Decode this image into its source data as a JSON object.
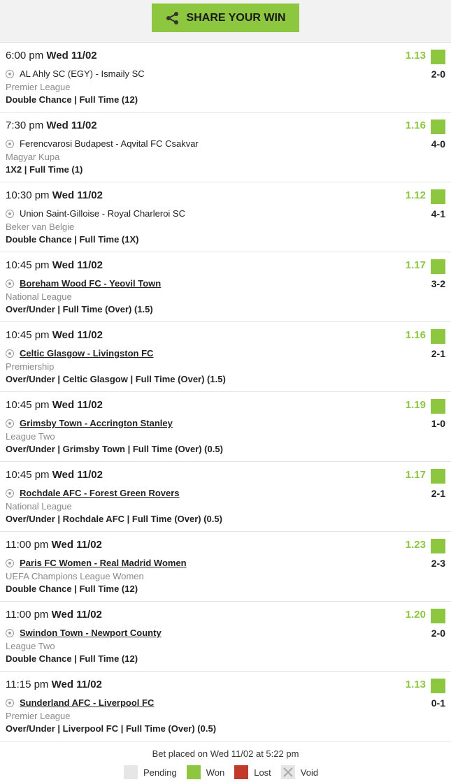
{
  "share_button": {
    "label": "SHARE YOUR WIN"
  },
  "bets": [
    {
      "time": "6:00 pm",
      "date": "Wed 11/02",
      "odds": "1.13",
      "match": "AL Ahly SC (EGY) - Ismaily SC",
      "linked": false,
      "score": "2-0",
      "league": "Premier League",
      "market": "Double Chance | Full Time (12)",
      "status": "won"
    },
    {
      "time": "7:30 pm",
      "date": "Wed 11/02",
      "odds": "1.16",
      "match": "Ferencvarosi Budapest - Aqvital FC Csakvar",
      "linked": false,
      "score": "4-0",
      "league": "Magyar Kupa",
      "market": "1X2 | Full Time (1)",
      "status": "won"
    },
    {
      "time": "10:30 pm",
      "date": "Wed 11/02",
      "odds": "1.12",
      "match": "Union Saint-Gilloise - Royal Charleroi SC",
      "linked": false,
      "score": "4-1",
      "league": "Beker van Belgie",
      "market": "Double Chance | Full Time (1X)",
      "status": "won"
    },
    {
      "time": "10:45 pm",
      "date": "Wed 11/02",
      "odds": "1.17",
      "match": "Boreham Wood FC - Yeovil Town",
      "linked": true,
      "score": "3-2",
      "league": "National League",
      "market": "Over/Under | Full Time (Over) (1.5)",
      "status": "won"
    },
    {
      "time": "10:45 pm",
      "date": "Wed 11/02",
      "odds": "1.16",
      "match": "Celtic Glasgow - Livingston FC",
      "linked": true,
      "score": "2-1",
      "league": "Premiership",
      "market": "Over/Under | Celtic Glasgow | Full Time (Over) (1.5)",
      "status": "won"
    },
    {
      "time": "10:45 pm",
      "date": "Wed 11/02",
      "odds": "1.19",
      "match": "Grimsby Town - Accrington Stanley",
      "linked": true,
      "score": "1-0",
      "league": "League Two",
      "market": "Over/Under | Grimsby Town | Full Time (Over) (0.5)",
      "status": "won"
    },
    {
      "time": "10:45 pm",
      "date": "Wed 11/02",
      "odds": "1.17",
      "match": "Rochdale AFC - Forest Green Rovers",
      "linked": true,
      "score": "2-1",
      "league": "National League",
      "market": "Over/Under | Rochdale AFC | Full Time (Over) (0.5)",
      "status": "won"
    },
    {
      "time": "11:00 pm",
      "date": "Wed 11/02",
      "odds": "1.23",
      "match": "Paris FC Women - Real Madrid Women",
      "linked": true,
      "score": "2-3",
      "league": "UEFA Champions League Women",
      "market": "Double Chance | Full Time (12)",
      "status": "won"
    },
    {
      "time": "11:00 pm",
      "date": "Wed 11/02",
      "odds": "1.20",
      "match": "Swindon Town - Newport County",
      "linked": true,
      "score": "2-0",
      "league": "League Two",
      "market": "Double Chance | Full Time (12)",
      "status": "won"
    },
    {
      "time": "11:15 pm",
      "date": "Wed 11/02",
      "odds": "1.13",
      "match": "Sunderland AFC - Liverpool FC",
      "linked": true,
      "score": "0-1",
      "league": "Premier League",
      "market": "Over/Under | Liverpool FC | Full Time (Over) (0.5)",
      "status": "won"
    }
  ],
  "footer": {
    "placed_text": "Bet placed on Wed 11/02 at 5:22 pm",
    "legend": [
      {
        "key": "pending",
        "label": "Pending",
        "color": "#e6e6e6"
      },
      {
        "key": "won",
        "label": "Won",
        "color": "#8dc63f"
      },
      {
        "key": "lost",
        "label": "Lost",
        "color": "#c0392b"
      },
      {
        "key": "void",
        "label": "Void",
        "color": "#e6e6e6"
      }
    ]
  },
  "colors": {
    "accent": "#8dc63f",
    "lost": "#c0392b"
  }
}
